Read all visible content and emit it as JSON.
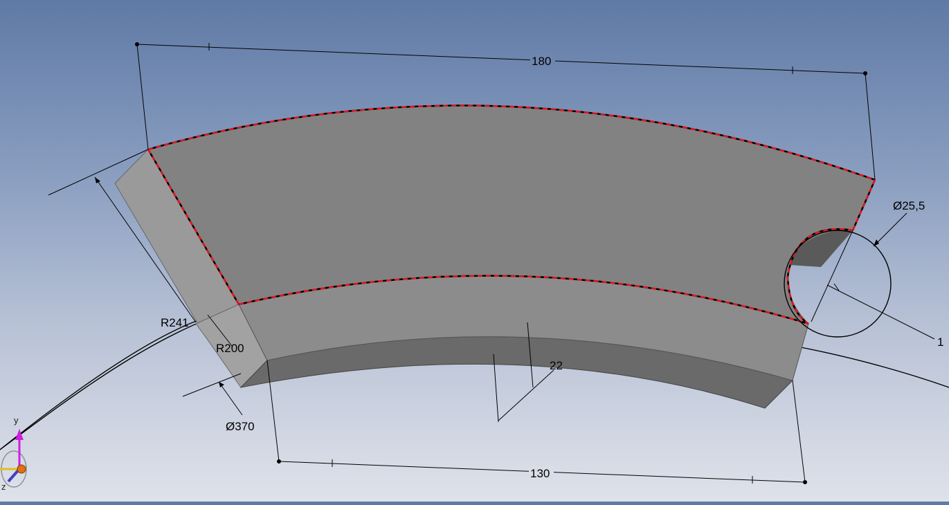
{
  "viewport": {
    "background_top": "#5f7aa6",
    "background_bottom": "#dfe2ea",
    "selection_color": "#e8141e",
    "part_face_color": "#828282"
  },
  "dimensions": {
    "top_length": "180",
    "bottom_length": "130",
    "hole_diameter": "Ø25,5",
    "hole_offset": "1",
    "outer_radius": "R241",
    "inner_radius": "R200",
    "ref_diameter": "Ø370",
    "thickness": "22"
  },
  "axes": {
    "y_label": "y",
    "z_label": "z",
    "y_color": "#d01ee0",
    "x_color": "#e0c020",
    "z_color": "#4040c0",
    "origin_color": "#e07010"
  }
}
